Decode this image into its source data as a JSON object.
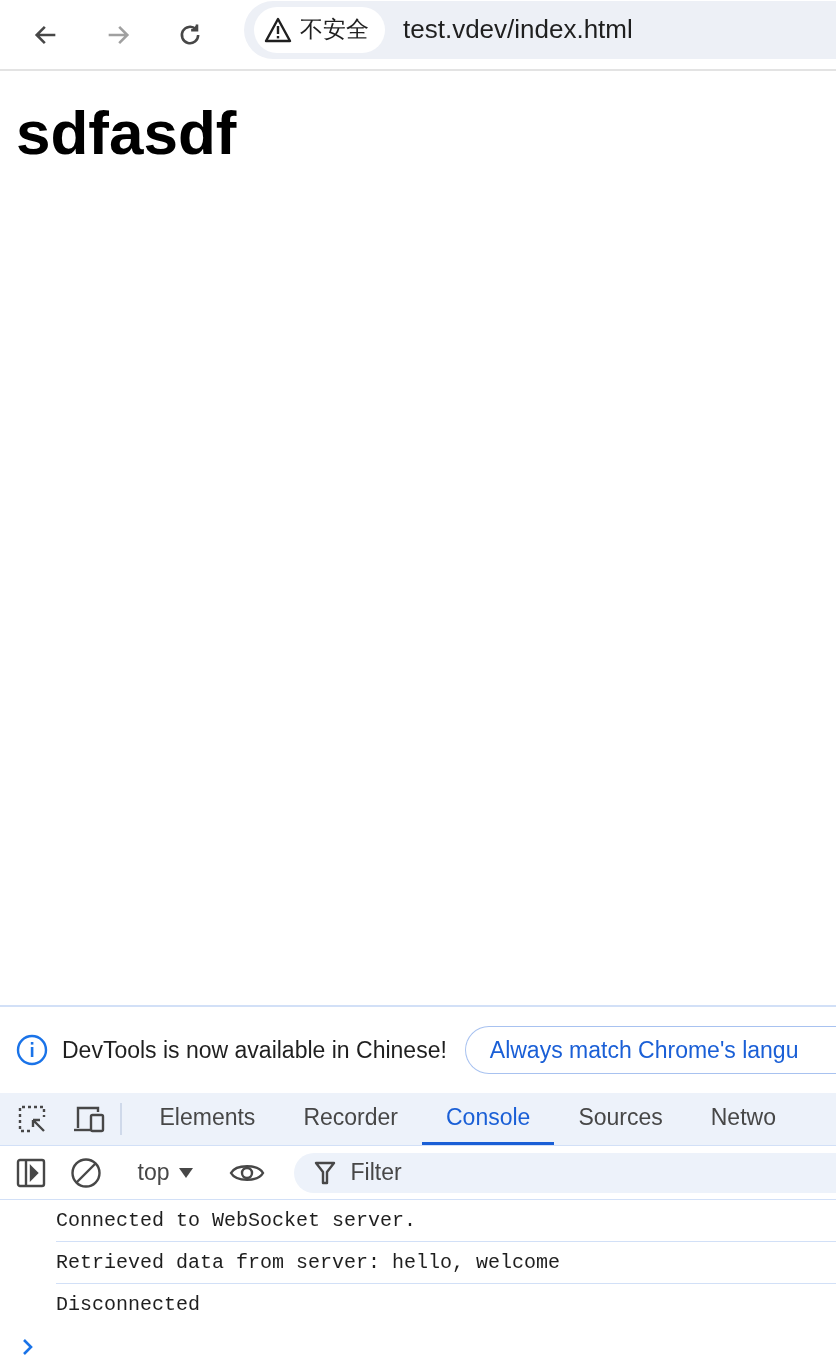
{
  "browser": {
    "back": {
      "disabled": false
    },
    "forward": {
      "disabled": true
    },
    "security_label": "不安全",
    "url": "test.vdev/index.html"
  },
  "page": {
    "heading": "sdfasdf"
  },
  "devtools": {
    "infobar": {
      "message": "DevTools is now available in Chinese!",
      "button": "Always match Chrome's langu"
    },
    "tabs": [
      {
        "label": "Elements",
        "selected": false
      },
      {
        "label": "Recorder",
        "selected": false
      },
      {
        "label": "Console",
        "selected": true
      },
      {
        "label": "Sources",
        "selected": false
      },
      {
        "label": "Netwo",
        "selected": false
      }
    ],
    "console_toolbar": {
      "context": "top",
      "filter_placeholder": "Filter"
    },
    "messages": [
      "Connected to WebSocket server.",
      "Retrieved data from server: hello, welcome",
      "Disconnected"
    ]
  }
}
